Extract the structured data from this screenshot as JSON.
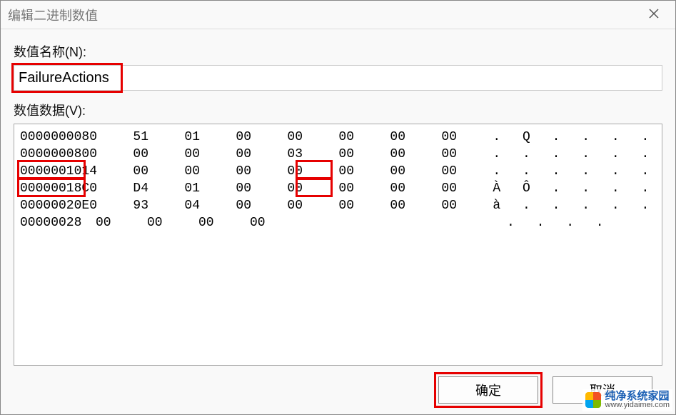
{
  "window": {
    "title": "编辑二进制数值"
  },
  "labels": {
    "value_name": "数值名称(N):",
    "value_data": "数值数据(V):"
  },
  "value_name": "FailureActions",
  "hex": {
    "rows": [
      {
        "offset": "00000000",
        "bytes": [
          "80",
          "51",
          "01",
          "00",
          "00",
          "00",
          "00",
          "00"
        ],
        "ascii": ". Q . . . . . ."
      },
      {
        "offset": "00000008",
        "bytes": [
          "00",
          "00",
          "00",
          "00",
          "03",
          "00",
          "00",
          "00"
        ],
        "ascii": ". . . . . . . ."
      },
      {
        "offset": "00000010",
        "bytes": [
          "14",
          "00",
          "00",
          "00",
          "00",
          "00",
          "00",
          "00"
        ],
        "ascii": ". . . . . . . ."
      },
      {
        "offset": "00000018",
        "bytes": [
          "C0",
          "D4",
          "01",
          "00",
          "00",
          "00",
          "00",
          "00"
        ],
        "ascii": "À Ô . . . . . ."
      },
      {
        "offset": "00000020",
        "bytes": [
          "E0",
          "93",
          "04",
          "00",
          "00",
          "00",
          "00",
          "00"
        ],
        "ascii": "à . . . . . . ."
      },
      {
        "offset": "00000028",
        "bytes": [
          "00",
          "00",
          "00",
          "00"
        ],
        "ascii": ". . . ."
      }
    ]
  },
  "buttons": {
    "ok": "确定",
    "cancel": "取消"
  },
  "watermark": {
    "line1": "纯净系统家园",
    "line2": "www.yidaimei.com"
  }
}
